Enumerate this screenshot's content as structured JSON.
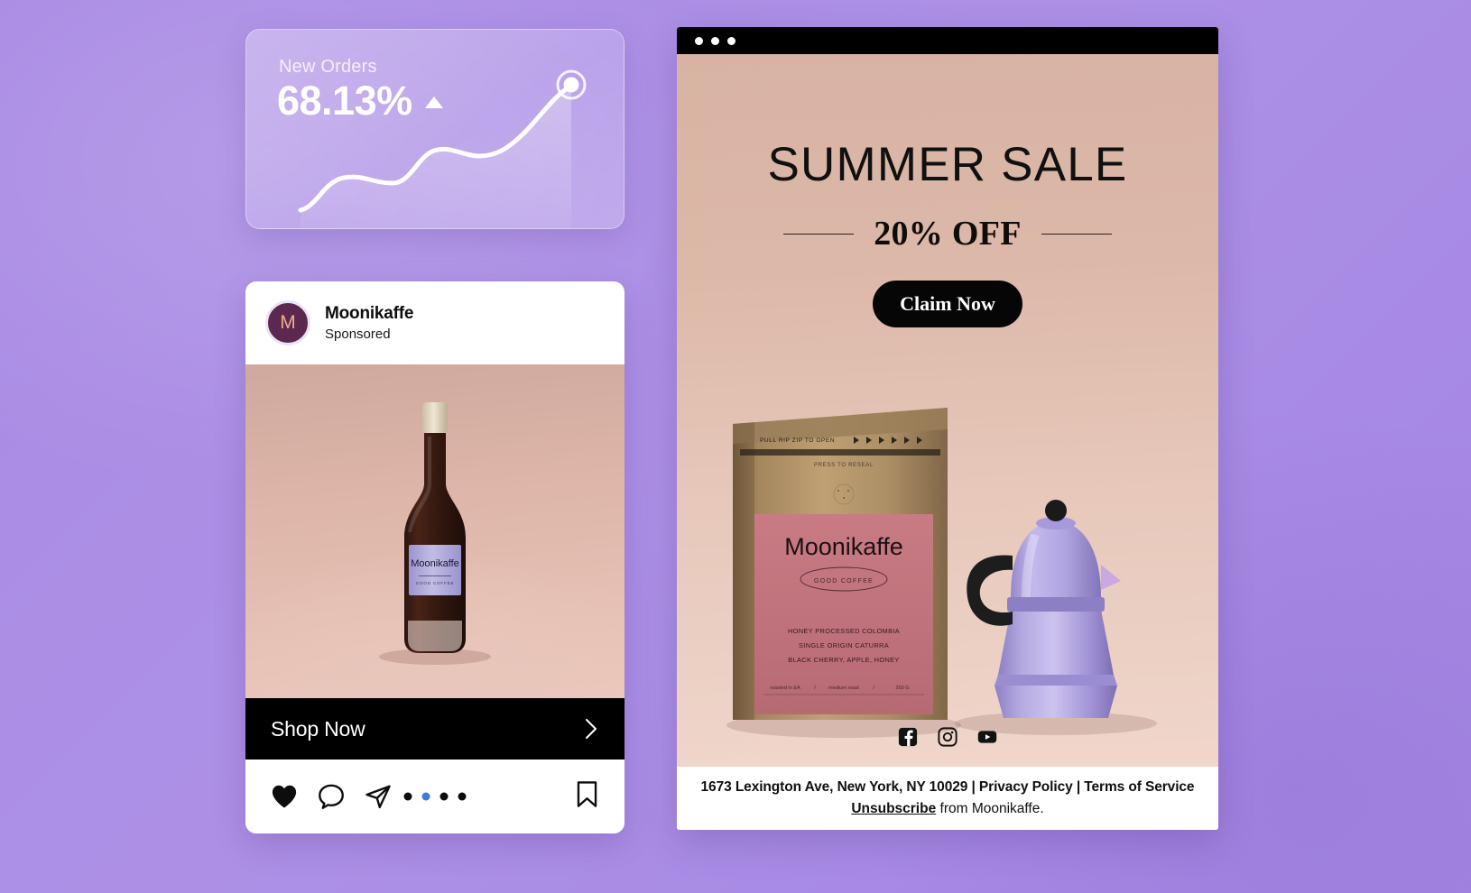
{
  "theme": {
    "background_purple": "#a98ae4",
    "accent_black": "#000000",
    "active_dot_blue": "#3f7ae0",
    "avatar_purple": "#5c2850",
    "avatar_letter_color": "#f0ad8a",
    "email_bg_tan": "#d8b3a3",
    "bag_label_pink": "#c4737c"
  },
  "stat_card": {
    "label": "New Orders",
    "value": "68.13%",
    "trend_icon": "triangle-up-icon"
  },
  "chart_data": {
    "type": "line",
    "title": "New Orders",
    "x": [
      0,
      1,
      2,
      3,
      4,
      5,
      6,
      7,
      8
    ],
    "values": [
      8,
      22,
      35,
      34,
      33,
      48,
      57,
      58,
      96
    ],
    "xlabel": "",
    "ylabel": "",
    "ylim": [
      0,
      100
    ],
    "grid": false,
    "legend": "none",
    "line_color": "#ffffff",
    "fill": "rgba(255,255,255,0.18)",
    "endpoint_marker": true
  },
  "post": {
    "avatar_letter": "M",
    "account_name": "Moonikaffe",
    "sponsored_label": "Sponsored",
    "product_label_brand": "Moonikaffe",
    "product_label_sub": "GOOD COFFEE",
    "cta_label": "Shop Now",
    "cta_chevron": "chevron-right-icon",
    "actions": [
      {
        "name": "like-icon",
        "label": "Like"
      },
      {
        "name": "comment-icon",
        "label": "Comment"
      },
      {
        "name": "share-icon",
        "label": "Share"
      }
    ],
    "bookmark": {
      "name": "bookmark-icon",
      "label": "Save"
    },
    "carousel": {
      "count": 4,
      "active_index": 1
    }
  },
  "email": {
    "window_dots": 3,
    "headline": "SUMMER SALE",
    "subheadline": "20% OFF",
    "cta_label": "Claim Now",
    "bag": {
      "zip_text": "PULL RIP ZIP TO OPEN",
      "reseal_text": "PRESS TO RESEAL",
      "brand": "Moonikaffe",
      "brand_sub": "GOOD COFFEE",
      "detail_lines": [
        "HONEY PROCESSED COLOMBIA",
        "SINGLE ORIGIN CATURRA",
        "BLACK CHERRY, APPLE, HONEY"
      ],
      "footer_left": "roasted in EA",
      "footer_mid": "medium roast",
      "footer_right": "250 G"
    },
    "social_icons": [
      {
        "name": "facebook-icon",
        "label": "Facebook"
      },
      {
        "name": "instagram-icon",
        "label": "Instagram"
      },
      {
        "name": "youtube-icon",
        "label": "YouTube"
      }
    ],
    "footer": {
      "line_1": "1673 Lexington Ave, New York, NY  10029 |  Privacy Policy | Terms of Service",
      "unsubscribe_label": "Unsubscribe",
      "line_2_rest": " from  Moonikaffe."
    }
  }
}
